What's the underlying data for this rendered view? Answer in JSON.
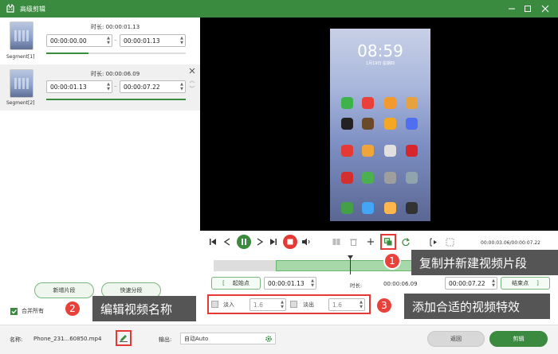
{
  "window": {
    "title": "高级剪辑"
  },
  "segments": [
    {
      "label": "Segment[1]",
      "duration_label": "时长:",
      "duration": "00:00:01.13",
      "start": "00:00:00.00",
      "end": "00:00:01.13",
      "progress": 0.3
    },
    {
      "label": "Segment[2]",
      "duration_label": "时长:",
      "duration": "00:00:06.09",
      "start": "00:00:01.13",
      "end": "00:00:07.22",
      "progress": 1.0
    }
  ],
  "left_buttons": {
    "new_segment": "新增片段",
    "quick_split": "快速分段"
  },
  "merge_all": {
    "label": "合并所有",
    "checked": true
  },
  "callouts": [
    {
      "num": "1",
      "text": "复制并新建视频片段"
    },
    {
      "num": "2",
      "text": "编辑视频名称"
    },
    {
      "num": "3",
      "text": "添加合适的视频特效"
    }
  ],
  "preview": {
    "clock": "08:59",
    "date": "1月19日 星期四"
  },
  "player": {
    "time_readout": "00:00:03.06/00:00:07.22"
  },
  "trim": {
    "start_label": "起始点",
    "start_time": "00:00:01.13",
    "duration_label": "时长:",
    "duration": "00:00:06.09",
    "end_time": "00:00:07.22",
    "end_label": "结束点"
  },
  "effects": {
    "fade_in_label": "淡入",
    "fade_in_value": "1.6",
    "fade_out_label": "淡出",
    "fade_out_value": "1.6"
  },
  "footer": {
    "name_label": "名称:",
    "name_value": "Phone_231...60850.mp4",
    "output_label": "输出:",
    "output_value": "自动Auto",
    "back_button": "返回",
    "cut_button": "剪辑"
  },
  "colors": {
    "accent": "#3a8a3f",
    "callout_bg": "#555555",
    "badge": "#e8413b",
    "highlight": "#e53935"
  }
}
